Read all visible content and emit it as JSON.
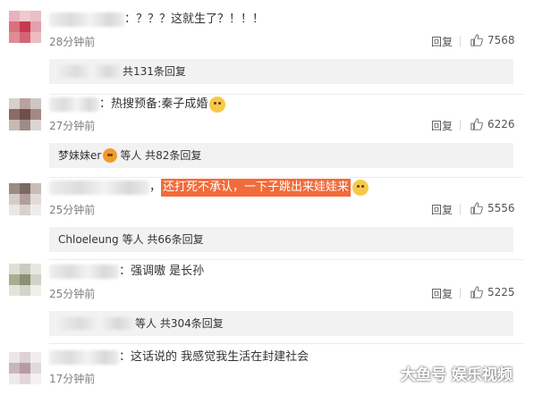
{
  "comments": [
    {
      "text": "：？？？这就生了？！！！",
      "time": "28分钟前",
      "reply": "回复",
      "likes": "7568",
      "sub": "共131条回复"
    },
    {
      "prefix": "：热搜预备: ",
      "highlight": "秦子成婚",
      "time": "27分钟前",
      "reply": "回复",
      "likes": "6226",
      "sub_user": "梦妹妹er",
      "sub": "等人 共82条回复"
    },
    {
      "prefix": "，",
      "highlight": "还打死不承认，一下子跳出来娃娃来",
      "time": "25分钟前",
      "reply": "回复",
      "likes": "5556",
      "sub_user": "Chloeleung",
      "sub": "等人 共66条回复"
    },
    {
      "text": "：强调嗷 是长孙",
      "time": "25分钟前",
      "reply": "回复",
      "likes": "5225",
      "sub": "等人 共304条回复"
    },
    {
      "text": "：这话说的 我感觉我生活在封建社会",
      "time": "17分钟前"
    }
  ],
  "icons": {
    "like": "thumbs-up-icon",
    "emoji": "doge-emoji-icon"
  },
  "watermark": "大鱼号 娱乐视频"
}
